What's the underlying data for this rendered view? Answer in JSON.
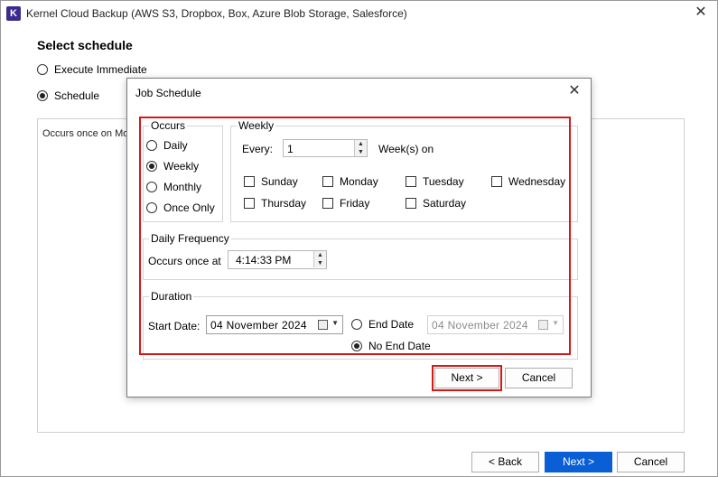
{
  "window": {
    "logo_letter": "K",
    "title": "Kernel Cloud Backup (AWS S3, Dropbox, Box, Azure Blob Storage, Salesforce)",
    "close_glyph": "✕"
  },
  "main": {
    "section_title": "Select schedule",
    "options": [
      {
        "label": "Execute Immediate",
        "checked": false
      },
      {
        "label": "Schedule",
        "checked": true
      }
    ],
    "panel_text": "Occurs once on Mo",
    "buttons": {
      "back": "< Back",
      "next": "Next >",
      "cancel": "Cancel"
    }
  },
  "dialog": {
    "title": "Job Schedule",
    "close_glyph": "✕",
    "occurs": {
      "label": "Occurs",
      "options": [
        {
          "label": "Daily",
          "checked": false
        },
        {
          "label": "Weekly",
          "checked": true
        },
        {
          "label": "Monthly",
          "checked": false
        },
        {
          "label": "Once Only",
          "checked": false
        }
      ]
    },
    "weekly": {
      "label": "Weekly",
      "every_label": "Every:",
      "every_value": "1",
      "weeks_on_label": "Week(s) on",
      "days": [
        {
          "label": "Sunday",
          "checked": false
        },
        {
          "label": "Monday",
          "checked": false
        },
        {
          "label": "Tuesday",
          "checked": false
        },
        {
          "label": "Wednesday",
          "checked": false
        },
        {
          "label": "Thursday",
          "checked": false
        },
        {
          "label": "Friday",
          "checked": false
        },
        {
          "label": "Saturday",
          "checked": false
        }
      ]
    },
    "daily_frequency": {
      "label": "Daily Frequency",
      "occurs_once_label": "Occurs once at",
      "time_value": "4:14:33 PM"
    },
    "duration": {
      "label": "Duration",
      "start_label": "Start Date:",
      "start_value": "04  November  2024",
      "end_label": "End Date",
      "end_value": "04  November  2024",
      "no_end_label": "No End Date",
      "end_checked": false,
      "no_end_checked": true
    },
    "buttons": {
      "next": "Next >",
      "cancel": "Cancel"
    }
  },
  "colors": {
    "highlight": "#d51818",
    "primary_button": "#0a5fd6"
  }
}
